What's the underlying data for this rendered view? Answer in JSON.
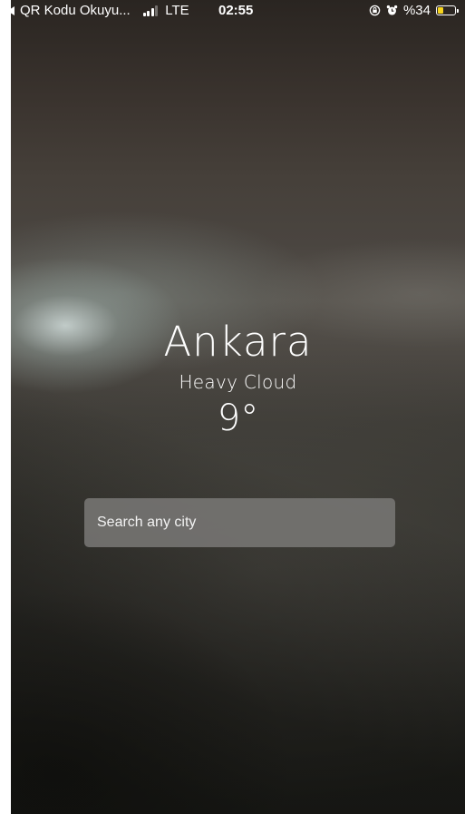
{
  "status_bar": {
    "back_label": "QR Kodu Okuyu...",
    "network": "LTE",
    "time": "02:55",
    "battery_text": "%34",
    "battery_level_percent": 34,
    "battery_color": "#f7d51d",
    "icons": [
      "back-arrow-icon",
      "signal-bars-icon",
      "orientation-lock-icon",
      "alarm-icon",
      "battery-icon"
    ]
  },
  "weather": {
    "city": "Ankara",
    "condition": "Heavy Cloud",
    "temperature": "9°"
  },
  "search": {
    "placeholder": "Search any city",
    "value": ""
  }
}
